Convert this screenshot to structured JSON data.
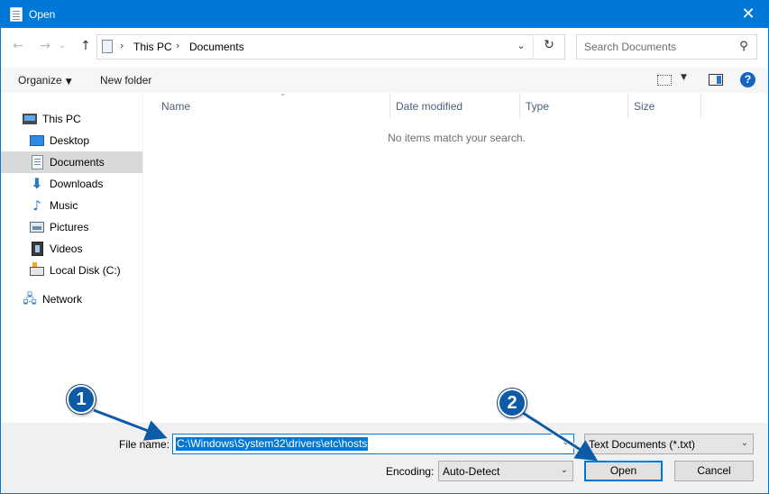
{
  "window": {
    "title": "Open",
    "close_glyph": "✕"
  },
  "nav": {
    "back_glyph": "←",
    "forward_glyph": "→",
    "recent_glyph": "⌄",
    "up_glyph": "↑"
  },
  "address": {
    "crumbs": [
      "This PC",
      "Documents"
    ],
    "separator": "›",
    "dropdown_glyph": "⌄",
    "refresh_glyph": "↻"
  },
  "search": {
    "placeholder": "Search Documents",
    "icon_glyph": "⚲"
  },
  "toolbar": {
    "organize": "Organize",
    "new_folder": "New folder",
    "help": "?"
  },
  "sidebar": {
    "items": [
      {
        "label": "This PC",
        "icon": "this-pc-icon"
      },
      {
        "label": "Desktop",
        "icon": "desktop-icon"
      },
      {
        "label": "Documents",
        "icon": "documents-icon",
        "selected": true
      },
      {
        "label": "Downloads",
        "icon": "downloads-icon"
      },
      {
        "label": "Music",
        "icon": "music-icon"
      },
      {
        "label": "Pictures",
        "icon": "pictures-icon"
      },
      {
        "label": "Videos",
        "icon": "videos-icon"
      },
      {
        "label": "Local Disk (C:)",
        "icon": "local-disk-icon"
      },
      {
        "label": "Network",
        "icon": "network-icon"
      }
    ]
  },
  "filelist": {
    "columns": [
      "Name",
      "Date modified",
      "Type",
      "Size"
    ],
    "empty_message": "No items match your search."
  },
  "bottom": {
    "file_name_label": "File name:",
    "file_name_value": "C:\\Windows\\System32\\drivers\\etc\\hosts",
    "file_type_value": "Text Documents (*.txt)",
    "encoding_label": "Encoding:",
    "encoding_value": "Auto-Detect",
    "open_label": "Open",
    "cancel_label": "Cancel"
  },
  "annotations": {
    "marker_1": "1",
    "marker_2": "2",
    "color": "#0d5aa7"
  }
}
